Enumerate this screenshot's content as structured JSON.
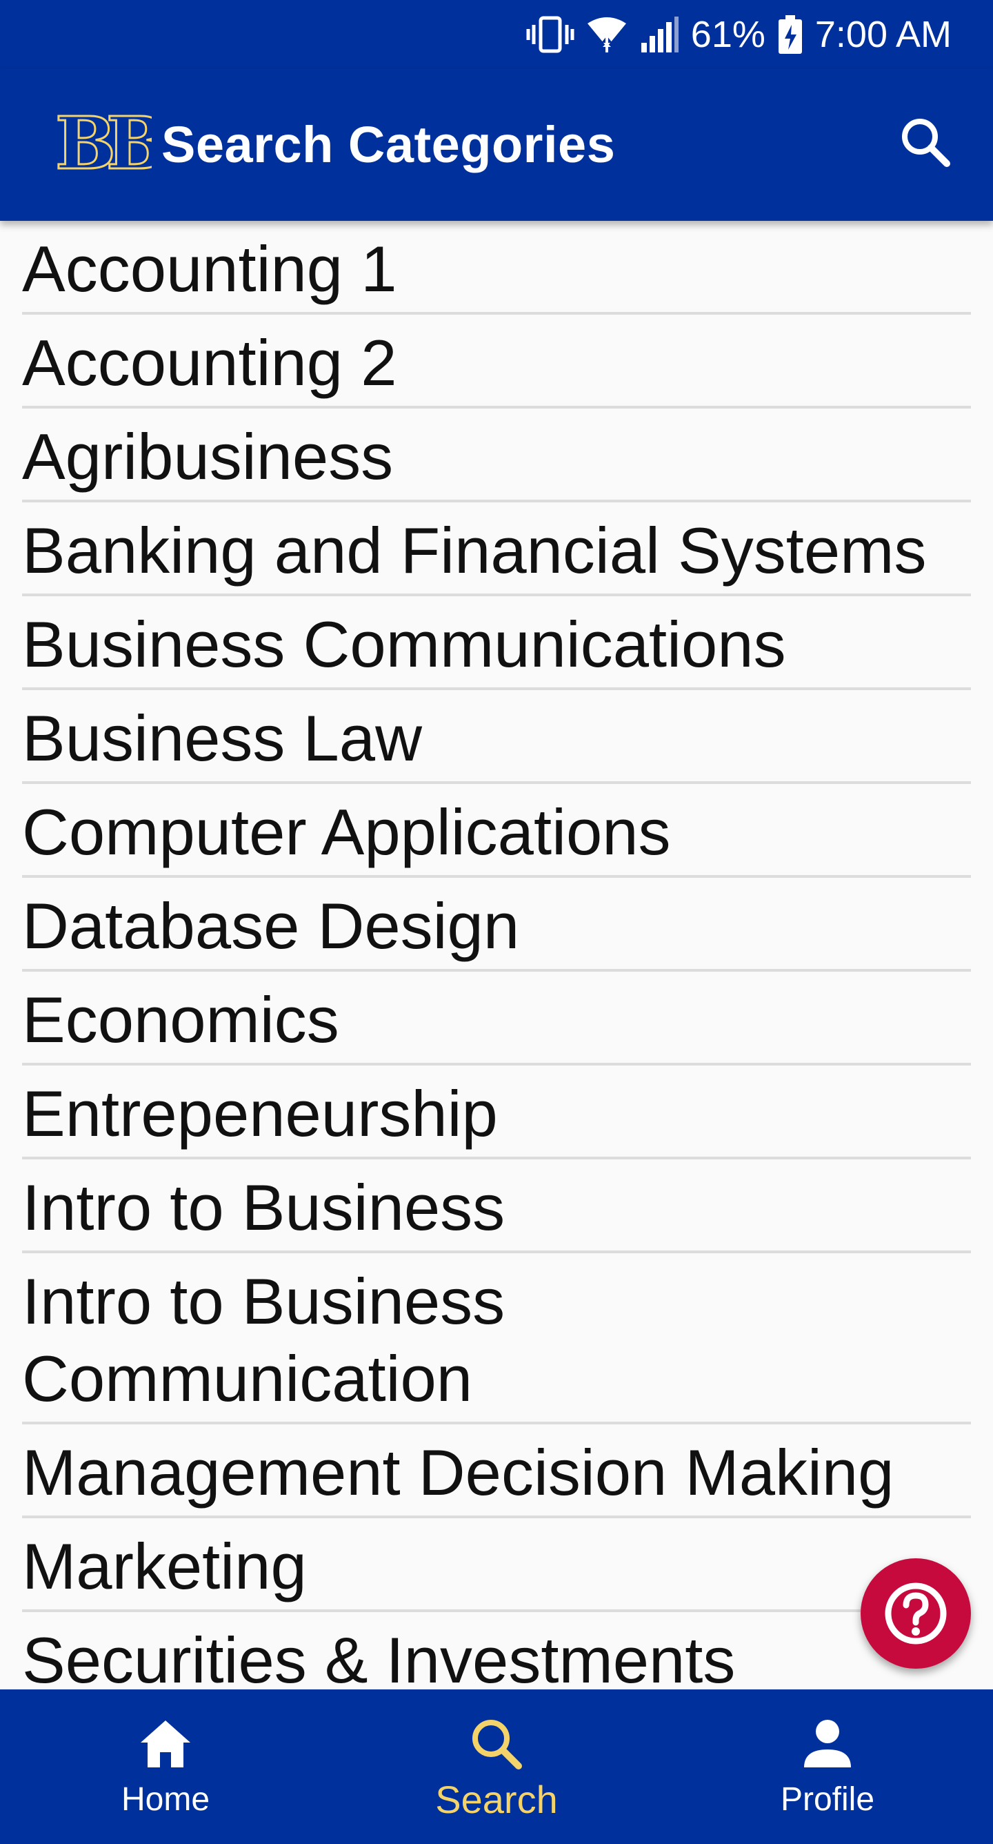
{
  "status_bar": {
    "battery_percent": "61%",
    "time": "7:00 AM",
    "icons": [
      "vibrate-icon",
      "wifi-icon",
      "signal-icon",
      "battery-charging-icon"
    ]
  },
  "app_bar": {
    "logo_text": "BB",
    "title": "Search Categories",
    "search_icon": "search-icon"
  },
  "categories": [
    {
      "label": "Accounting 1"
    },
    {
      "label": "Accounting 2"
    },
    {
      "label": "Agribusiness"
    },
    {
      "label": "Banking and Financial Systems"
    },
    {
      "label": "Business Communications"
    },
    {
      "label": "Business Law"
    },
    {
      "label": "Computer Applications"
    },
    {
      "label": "Database Design"
    },
    {
      "label": "Economics"
    },
    {
      "label": "Entrepeneurship"
    },
    {
      "label": "Intro to Business"
    },
    {
      "label": "Intro to Business Communication"
    },
    {
      "label": "Management Decision Making"
    },
    {
      "label": "Marketing"
    },
    {
      "label": "Securities & Investments"
    }
  ],
  "help_button": {
    "icon": "help-circle-icon"
  },
  "bottom_nav": {
    "items": [
      {
        "label": "Home",
        "icon": "home-icon",
        "active": false
      },
      {
        "label": "Search",
        "icon": "search-icon",
        "active": true
      },
      {
        "label": "Profile",
        "icon": "person-icon",
        "active": false
      }
    ]
  },
  "colors": {
    "primary": "#00309b",
    "accent": "#f4d36b",
    "fab": "#c70a3d",
    "background": "#fafafa",
    "divider": "#dcdcdc"
  }
}
